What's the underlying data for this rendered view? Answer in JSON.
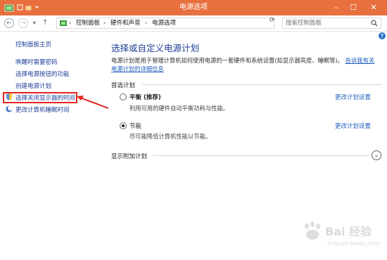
{
  "window": {
    "title": "电源选项",
    "titlebar_color": "#e8703f"
  },
  "address": {
    "breadcrumbs": [
      "控制面板",
      "硬件和声音",
      "电源选项"
    ],
    "search_placeholder": "搜索控制面板"
  },
  "sidebar": {
    "home": "控制面板主页",
    "items": [
      {
        "label": "唤醒时需要密码",
        "icon": null
      },
      {
        "label": "选择电源按钮的功能",
        "icon": null
      },
      {
        "label": "创建电源计划",
        "icon": null
      },
      {
        "label": "选择关闭显示器的时间",
        "icon": "shield-icon",
        "highlighted": true
      },
      {
        "label": "更改计算机睡眠时间",
        "icon": "moon-icon"
      }
    ],
    "highlight_color": "#e2261f"
  },
  "main": {
    "title": "选择或自定义电源计划",
    "description_text": "电源计划是用于管理计算机如何使用电源的一套硬件和系统设置(如显示器亮度、睡眠等)。",
    "description_link_1": "告诉我有关",
    "description_link_2": "电源计划的详细信息",
    "preferred_label": "首选计划",
    "plans": [
      {
        "name": "平衡 (推荐)",
        "description": "利用可用的硬件自动平衡功耗与性能。",
        "selected": false,
        "link": "更改计划设置"
      },
      {
        "name": "节能",
        "description": "尽可能降低计算机性能以节能。",
        "selected": true,
        "link": "更改计划设置"
      }
    ],
    "more_label": "显示附加计划"
  },
  "accent_color": "#1d3e94",
  "link_color": "#1f5fbf",
  "watermark": {
    "text": "Bai 经验",
    "sub": "jingyan.baidu.com"
  }
}
